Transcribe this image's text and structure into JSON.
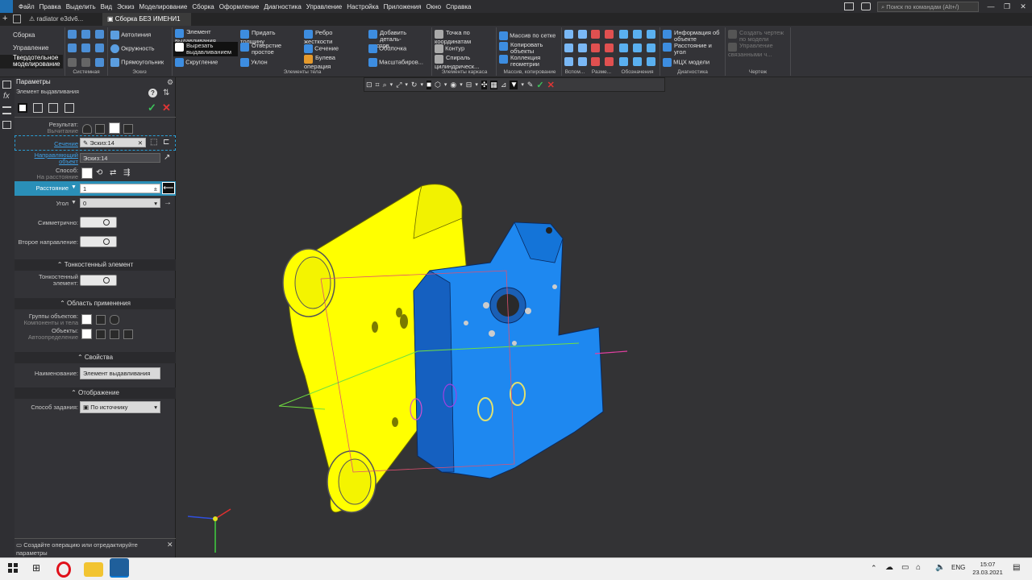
{
  "menu": {
    "items": [
      "Файл",
      "Правка",
      "Выделить",
      "Вид",
      "Эскиз",
      "Моделирование",
      "Сборка",
      "Оформление",
      "Диагностика",
      "Управление",
      "Настройка",
      "Приложения",
      "Окно",
      "Справка"
    ],
    "search_placeholder": "Поиск по командам (Alt+/)"
  },
  "tabs": [
    "radiator e3dv6...",
    "Сборка БЕЗ ИМЕНИ1"
  ],
  "ribbon": {
    "modes": [
      "Сборка",
      "Управление",
      "Твердотельное\nмоделирование"
    ],
    "buttons": {
      "avtolinia": "Автолиния",
      "okruzhnost": "Окружность",
      "pryamougolnik": "Прямоугольник",
      "element_vydavlivaniya": "Элемент\nвыдавливания",
      "vyrezat": "Вырезать\nвыдавливанием",
      "skruglenie": "Скругление",
      "pridat_tolshchinu": "Придать\nтолщину",
      "otverstie": "Отверстие\nпростое",
      "uklon": "Уклон",
      "rebro": "Ребро\nжесткости",
      "sechenie": "Сечение",
      "buleva": "Булева\nоперация",
      "dobavit_detal": "Добавить\nдеталь-заготов...",
      "obolochka": "Оболочка",
      "masshtabirov": "Масштабиров...",
      "tochka": "Точка по\nкоординатам",
      "kontur": "Контур",
      "spiral": "Спираль\nцилиндрическ...",
      "massiv": "Массив по сетке",
      "kopirovat": "Копировать\nобъекты",
      "kollekciya": "Коллекция\nгеометрии",
      "informaciya": "Информация об\nобъекте",
      "rasstoyanie": "Расстояние и\nугол",
      "mcx": "МЦХ модели",
      "sozdat_chertezh": "Создать чертеж\nпо модели",
      "upravlenie_svyaz": "Управление\nсвязанными ч..."
    },
    "groups": [
      "Системная",
      "Эскиз",
      "Элементы тела",
      "Элементы каркаса",
      "Массив, копирование",
      "Вспом...",
      "Разме...",
      "Обозначения",
      "Диагностика",
      "Чертеж"
    ]
  },
  "panel": {
    "title": "Параметры",
    "subtitle": "Элемент выдавливания",
    "result_label": "Результат:",
    "result_value": "Вычитание",
    "section_label": "Сечение",
    "section_value": "Эскиз:14",
    "direction_label": "Направляющий\nобъект",
    "direction_value": "Эскиз:14",
    "method_label": "Способ:",
    "method_value": "На расстояние",
    "distance_label": "Расстояние",
    "distance_value": "1",
    "angle_label": "Угол",
    "angle_value": "0",
    "symmetric_label": "Симметрично:",
    "second_dir_label": "Второе направление:",
    "thin_section": "Тонкостенный элемент",
    "thin_label": "Тонкостенный\nэлемент:",
    "scope_section": "Область применения",
    "groups_label": "Группы объектов:",
    "groups_value": "Компоненты и тела",
    "objects_label": "Объекты:",
    "objects_value": "Автоопределение",
    "props_section": "Свойства",
    "name_label": "Наименование:",
    "name_value": "Элемент выдавливания",
    "display_section": "Отображение",
    "assign_label": "Способ задания:",
    "assign_value": "По источнику",
    "hint": "Создайте операцию или отредактируйте параметры"
  },
  "taskbar": {
    "lang": "ENG",
    "time": "15:07",
    "date": "23.03.2021"
  },
  "colors": {
    "yellow_part": "#ffff00",
    "blue_part": "#1e88f0",
    "accent": "#2a9fd6"
  }
}
